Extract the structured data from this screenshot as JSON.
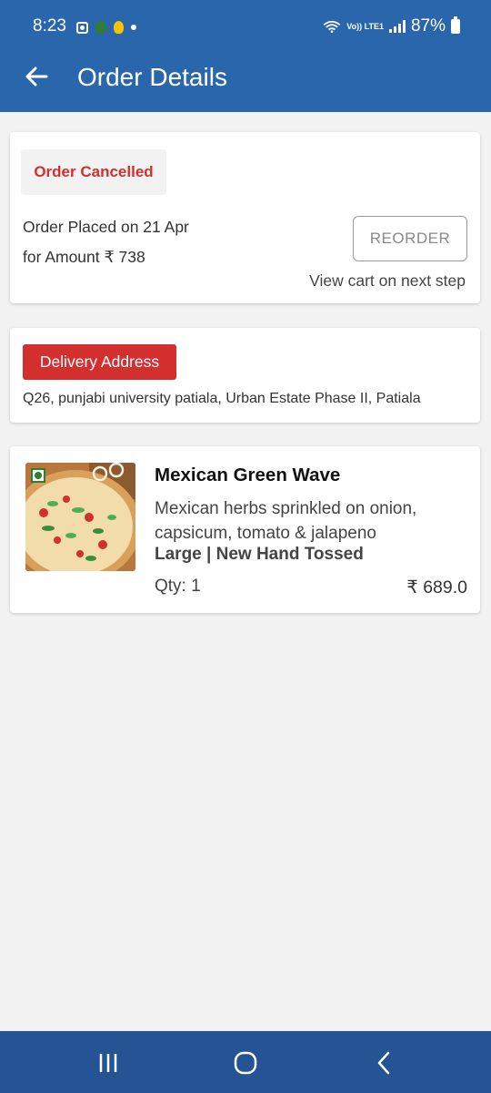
{
  "status_bar": {
    "time": "8:23",
    "battery": "87%",
    "network": "Vo)) LTE1"
  },
  "header": {
    "title": "Order Details"
  },
  "order": {
    "status": "Order Cancelled",
    "placed_on": "Order Placed on 21 Apr",
    "amount": "for Amount ₹ 738",
    "reorder_label": "REORDER",
    "reorder_hint": "View cart on next step"
  },
  "address": {
    "label": "Delivery Address",
    "text": "Q26, punjabi university patiala, Urban Estate Phase II, Patiala"
  },
  "item": {
    "name": "Mexican Green Wave",
    "description": "Mexican herbs sprinkled on onion, capsicum, tomato & jalapeno",
    "variant": "Large | New Hand Tossed",
    "qty": "Qty: 1",
    "price": "₹ 689.0"
  },
  "colors": {
    "primary": "#2a66ab",
    "nav": "#245494",
    "accent_red": "#d32f2f",
    "background": "#f2f2f2"
  },
  "icons": [
    "back-arrow-icon",
    "veg-mark-icon",
    "recents-icon",
    "home-icon",
    "back-icon"
  ]
}
